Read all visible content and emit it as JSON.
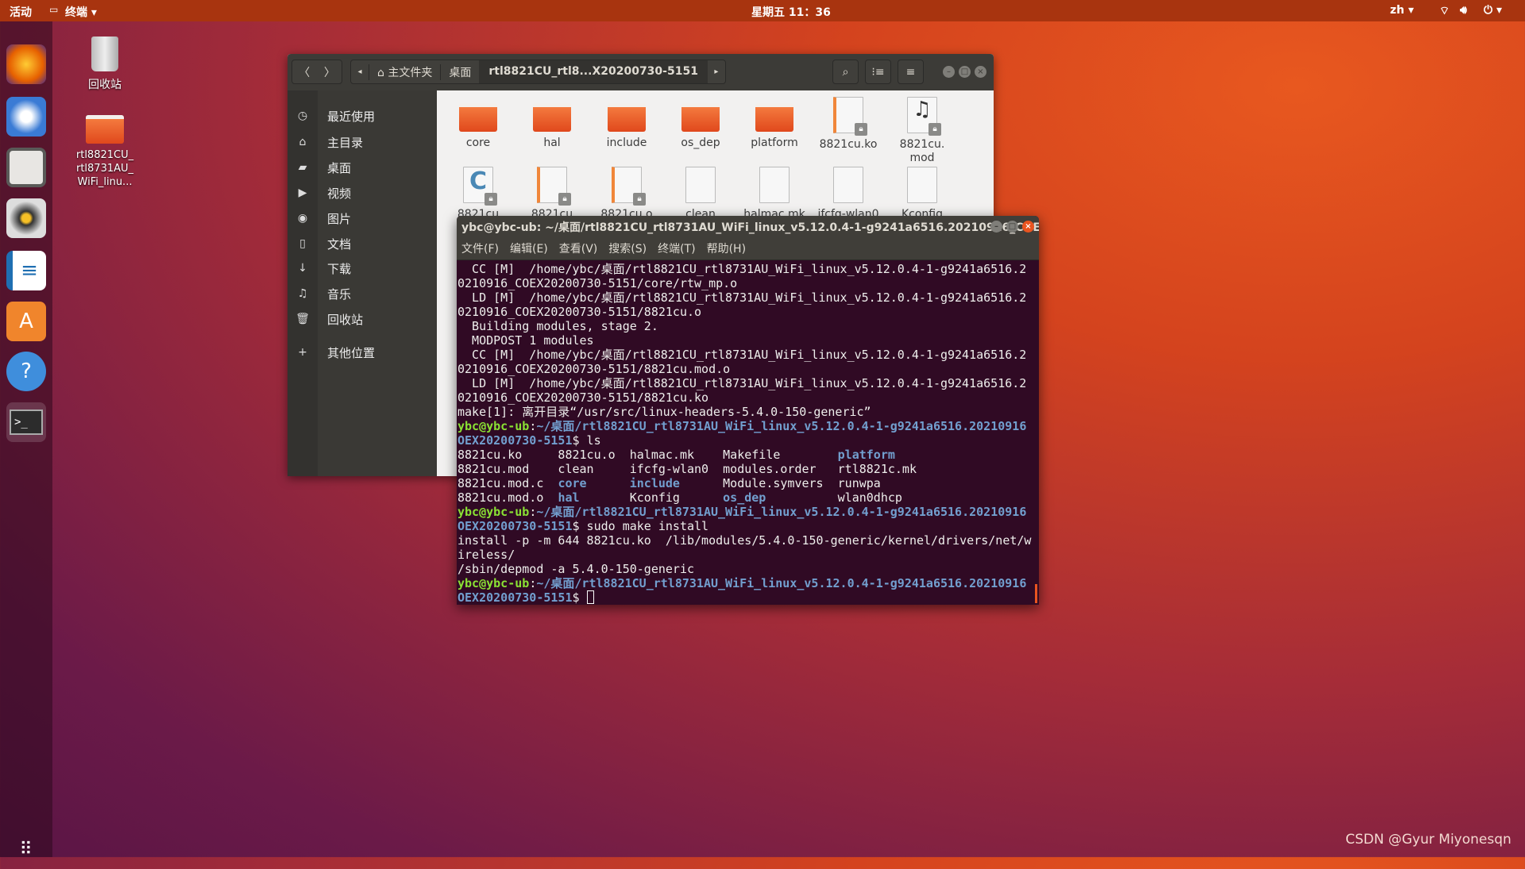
{
  "topbar": {
    "activities": "活动",
    "app": "终端",
    "clock": "星期五 11：36",
    "lang": "zh"
  },
  "dock": {
    "items": [
      "firefox-icon",
      "thunderbird-icon",
      "files-icon",
      "rhythmbox-icon",
      "writer-icon",
      "software-icon",
      "help-icon",
      "terminal-icon"
    ]
  },
  "desktop": {
    "trash": "回收站",
    "folder": "rtl8821CU_\nrtl8731AU_\nWiFi_linu..."
  },
  "files": {
    "breadcrumb": [
      "主文件夹",
      "桌面",
      "rtl8821CU_rtl8...X20200730-5151"
    ],
    "sidebar": [
      {
        "icon": "◷",
        "label": "最近使用"
      },
      {
        "icon": "⌂",
        "label": "主目录"
      },
      {
        "icon": "▰",
        "label": "桌面"
      },
      {
        "icon": "▶",
        "label": "视频"
      },
      {
        "icon": "◉",
        "label": "图片"
      },
      {
        "icon": "▯",
        "label": "文档"
      },
      {
        "icon": "↓",
        "label": "下载"
      },
      {
        "icon": "♫",
        "label": "音乐"
      },
      {
        "icon": "🗑",
        "label": "回收站"
      },
      {
        "icon": "+",
        "label": "其他位置"
      }
    ],
    "items": [
      {
        "name": "core",
        "type": "folder"
      },
      {
        "name": "hal",
        "type": "folder"
      },
      {
        "name": "include",
        "type": "folder"
      },
      {
        "name": "os_dep",
        "type": "folder"
      },
      {
        "name": "platform",
        "type": "folder"
      },
      {
        "name": "8821cu.ko",
        "type": "locked-doc"
      },
      {
        "name": "8821cu.\nmod",
        "type": "locked-audio"
      },
      {
        "name": "8821cu",
        "type": "locked-c"
      },
      {
        "name": "8821cu",
        "type": "locked-doc"
      },
      {
        "name": "8821cu.o",
        "type": "locked-doc"
      },
      {
        "name": "clean",
        "type": "script"
      },
      {
        "name": "halmac.mk",
        "type": "text"
      },
      {
        "name": "ifcfg-wlan0",
        "type": "text"
      },
      {
        "name": "Kconfig",
        "type": "text"
      }
    ]
  },
  "terminal": {
    "title": "ybc@ybc-ub: ~/桌面/rtl8821CU_rtl8731AU_WiFi_linux_v5.12.0.4-1-g9241a6516.20210916_COE...",
    "menu": [
      "文件(F)",
      "编辑(E)",
      "查看(V)",
      "搜索(S)",
      "终端(T)",
      "帮助(H)"
    ],
    "lines": [
      [
        [
          "",
          "  CC [M]  /home/ybc/桌面/rtl8821CU_rtl8731AU_WiFi_linux_v5.12.0.4-1-g9241a6516.2"
        ]
      ],
      [
        [
          "",
          "0210916_COEX20200730-5151/core/rtw_mp.o"
        ]
      ],
      [
        [
          "",
          "  LD [M]  /home/ybc/桌面/rtl8821CU_rtl8731AU_WiFi_linux_v5.12.0.4-1-g9241a6516.2"
        ]
      ],
      [
        [
          "",
          "0210916_COEX20200730-5151/8821cu.o"
        ]
      ],
      [
        [
          "",
          "  Building modules, stage 2."
        ]
      ],
      [
        [
          "",
          "  MODPOST 1 modules"
        ]
      ],
      [
        [
          "",
          "  CC [M]  /home/ybc/桌面/rtl8821CU_rtl8731AU_WiFi_linux_v5.12.0.4-1-g9241a6516.2"
        ]
      ],
      [
        [
          "",
          "0210916_COEX20200730-5151/8821cu.mod.o"
        ]
      ],
      [
        [
          "",
          "  LD [M]  /home/ybc/桌面/rtl8821CU_rtl8731AU_WiFi_linux_v5.12.0.4-1-g9241a6516.2"
        ]
      ],
      [
        [
          "",
          "0210916_COEX20200730-5151/8821cu.ko"
        ]
      ],
      [
        [
          "",
          "make[1]: 离开目录“/usr/src/linux-headers-5.4.0-150-generic”"
        ]
      ],
      [
        [
          "user",
          "ybc@ybc-ub"
        ],
        [
          "",
          ":"
        ],
        [
          "path",
          "~/桌面/rtl8821CU_rtl8731AU_WiFi_linux_v5.12.0.4-1-g9241a6516.20210916"
        ]
      ],
      [
        [
          "path",
          "OEX20200730-5151"
        ],
        [
          "",
          "$ ls"
        ]
      ],
      [
        [
          "",
          "8821cu.ko     8821cu.o  halmac.mk    Makefile        "
        ],
        [
          "dir",
          "platform"
        ]
      ],
      [
        [
          "",
          "8821cu.mod    clean     ifcfg-wlan0  modules.order   rtl8821c.mk"
        ]
      ],
      [
        [
          "",
          "8821cu.mod.c  "
        ],
        [
          "dir",
          "core"
        ],
        [
          "",
          "      "
        ],
        [
          "dir",
          "include"
        ],
        [
          "",
          "      Module.symvers  runwpa"
        ]
      ],
      [
        [
          "",
          "8821cu.mod.o  "
        ],
        [
          "dir",
          "hal"
        ],
        [
          "",
          "       Kconfig      "
        ],
        [
          "dir",
          "os_dep"
        ],
        [
          "",
          "          wlan0dhcp"
        ]
      ],
      [
        [
          "user",
          "ybc@ybc-ub"
        ],
        [
          "",
          ":"
        ],
        [
          "path",
          "~/桌面/rtl8821CU_rtl8731AU_WiFi_linux_v5.12.0.4-1-g9241a6516.20210916"
        ]
      ],
      [
        [
          "path",
          "OEX20200730-5151"
        ],
        [
          "",
          "$ sudo make install"
        ]
      ],
      [
        [
          "",
          "install -p -m 644 8821cu.ko  /lib/modules/5.4.0-150-generic/kernel/drivers/net/w"
        ]
      ],
      [
        [
          "",
          "ireless/"
        ]
      ],
      [
        [
          "",
          "/sbin/depmod -a 5.4.0-150-generic"
        ]
      ],
      [
        [
          "user",
          "ybc@ybc-ub"
        ],
        [
          "",
          ":"
        ],
        [
          "path",
          "~/桌面/rtl8821CU_rtl8731AU_WiFi_linux_v5.12.0.4-1-g9241a6516.20210916"
        ]
      ],
      [
        [
          "path",
          "OEX20200730-5151"
        ],
        [
          "",
          "$ "
        ]
      ]
    ]
  },
  "watermark": "CSDN @Gyur Miyonesqn",
  "colors": {
    "accent": "#e95420",
    "terminal_bg": "#300a24",
    "prompt_user": "#8ae234",
    "prompt_path": "#729fcf"
  }
}
